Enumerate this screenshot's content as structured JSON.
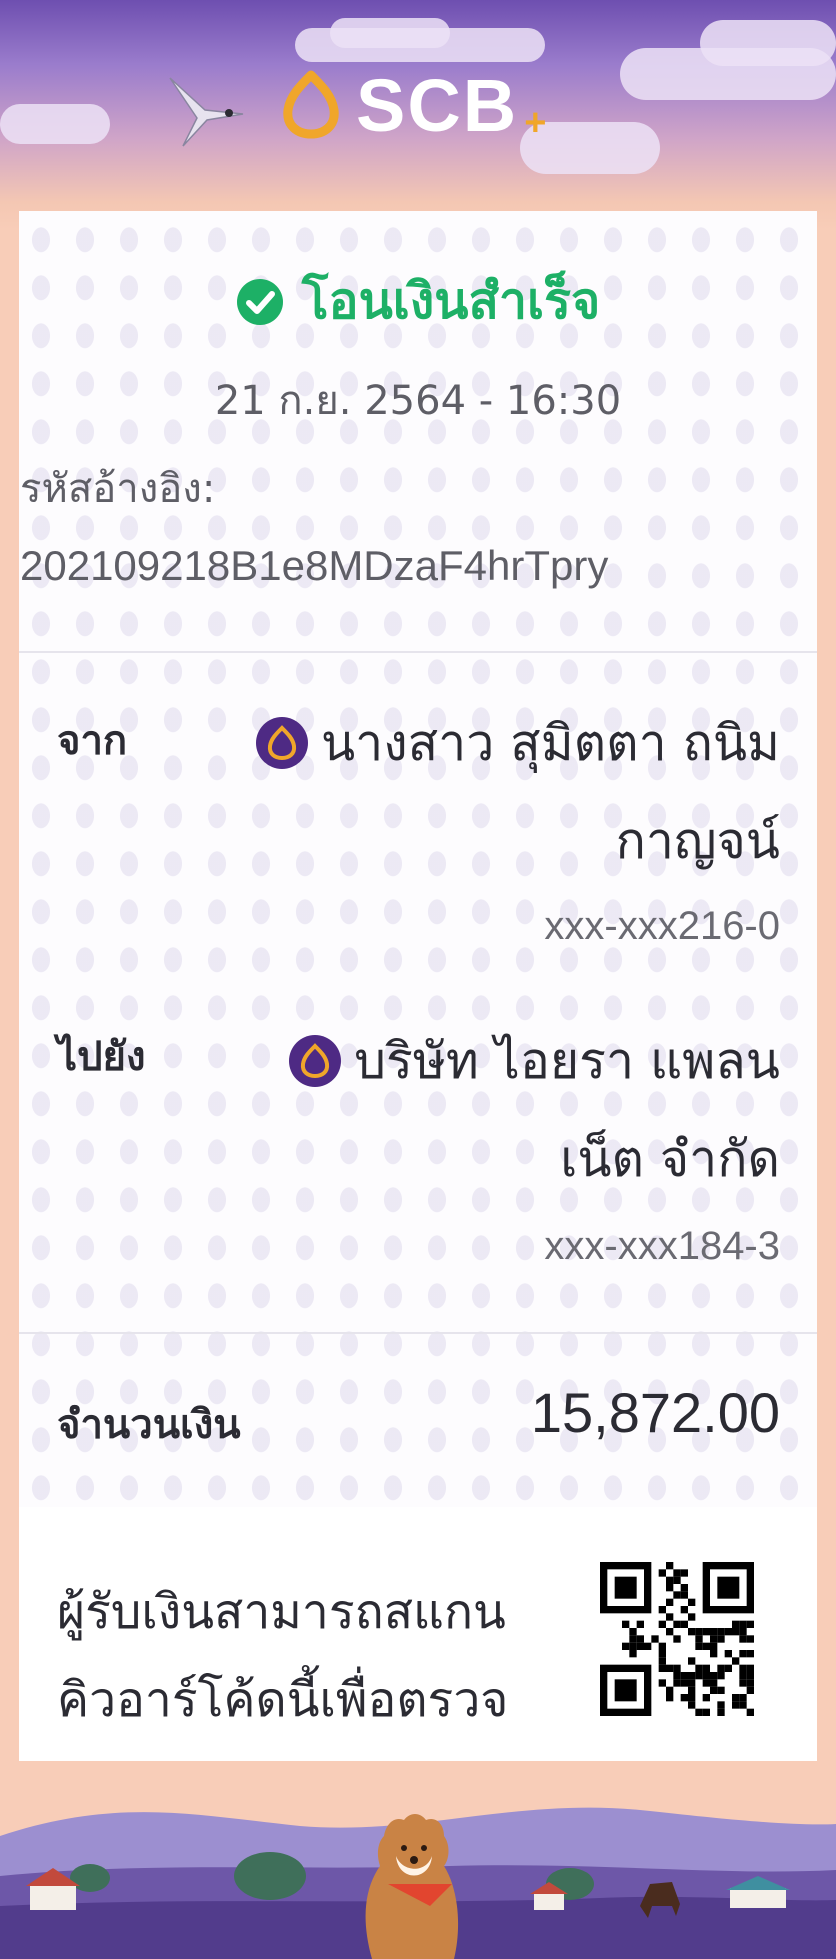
{
  "header": {
    "brand": "SCB",
    "brand_plus": "+"
  },
  "status": {
    "title": "โอนเงินสำเร็จ",
    "icon": "check-circle-icon",
    "color": "#1db066"
  },
  "datetime": "21 ก.ย. 2564 - 16:30",
  "reference": {
    "label": "รหัสอ้างอิง:",
    "value": "202109218B1e8MDzaF4hrTpry"
  },
  "from": {
    "label": "จาก",
    "name_line1": "นางสาว สุมิตตา ถนิม",
    "name_line2": "กาญจน์",
    "account": "xxx-xxx216-0",
    "bank_icon": "scb-bank-icon"
  },
  "to": {
    "label": "ไปยัง",
    "name_line1": "บริษัท ไอยรา แพลน",
    "name_line2": "เน็ต จำกัด",
    "account": "xxx-xxx184-3",
    "bank_icon": "scb-bank-icon"
  },
  "amount": {
    "label": "จำนวนเงิน",
    "value": "15,872.00"
  },
  "verify": {
    "line1": "ผู้รับเงินสามารถสแกน",
    "line2": "คิวอาร์โค้ดนี้เพื่อตรวจ"
  },
  "colors": {
    "brand_purple": "#4e2a84",
    "brand_gold": "#f0a62a",
    "success_green": "#1db066",
    "background_peach": "#f8cdb8"
  }
}
